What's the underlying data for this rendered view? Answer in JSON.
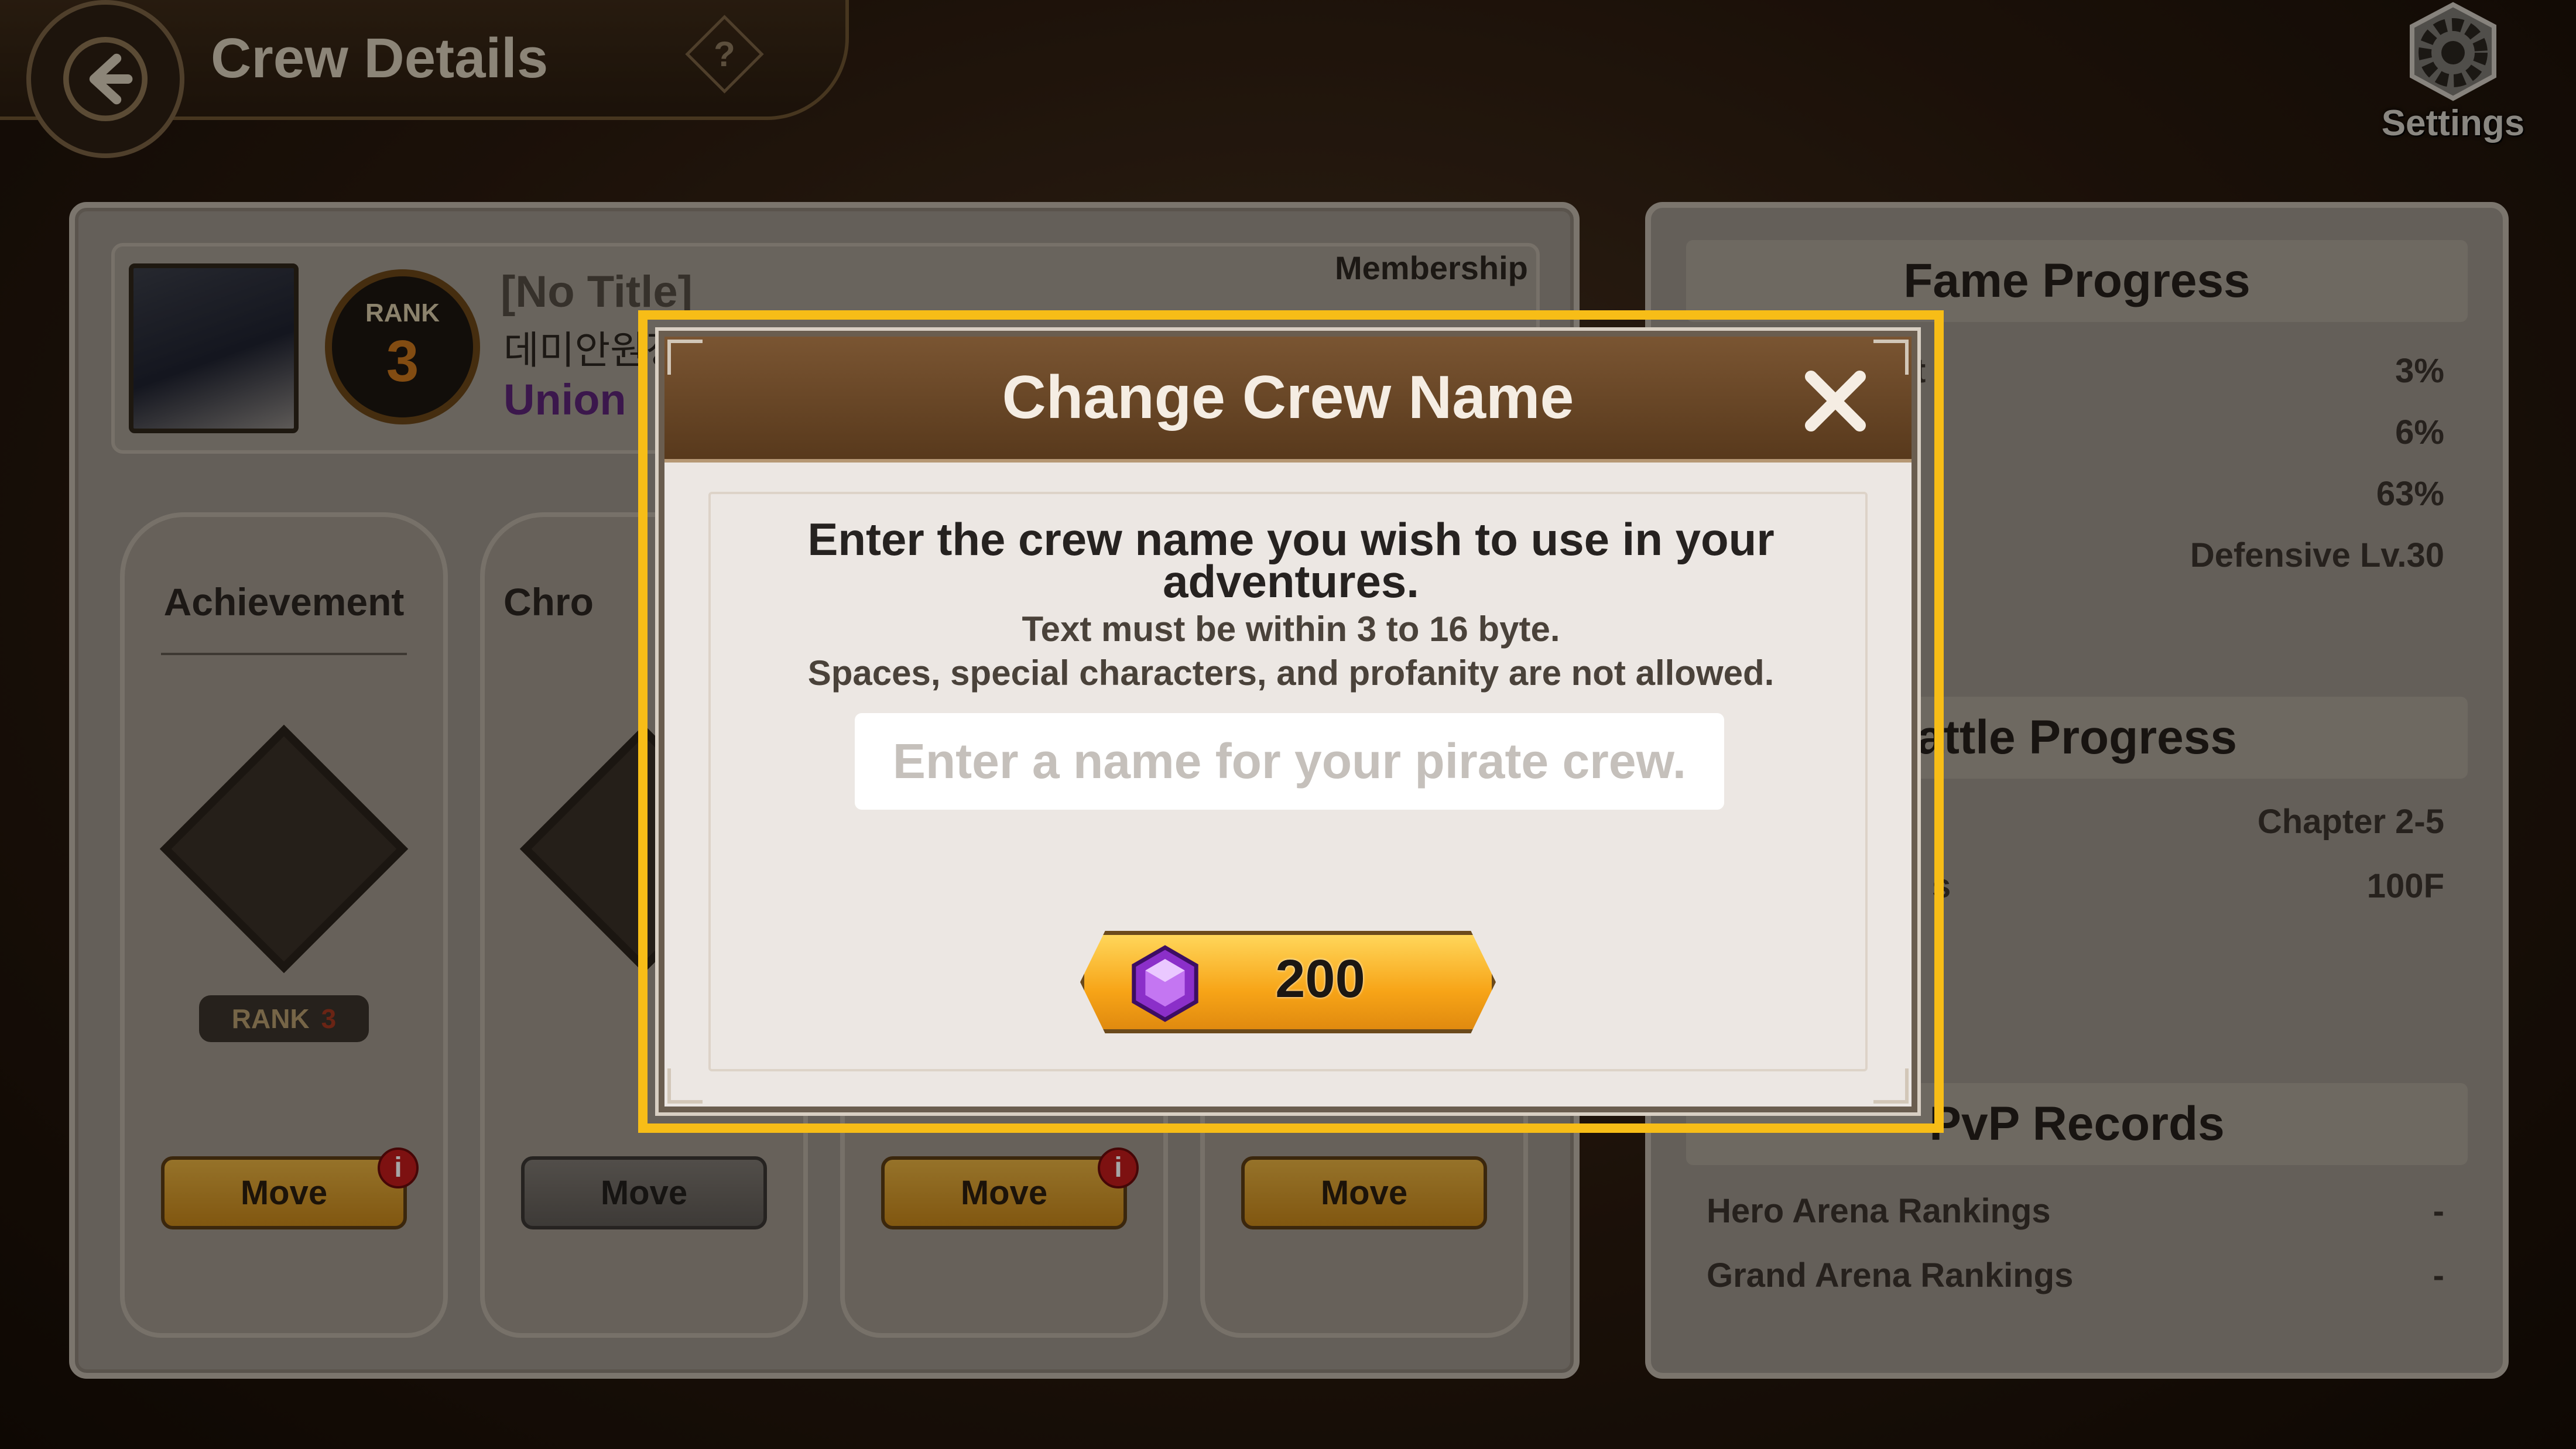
{
  "header": {
    "title": "Crew Details",
    "help_label": "?"
  },
  "settings": {
    "label": "Settings"
  },
  "profile": {
    "title": "[No Title]",
    "name": "데미안원정대",
    "union_label": "Union",
    "rank_label": "RANK",
    "rank_value": "3",
    "membership_label": "Membership"
  },
  "cards": [
    {
      "title": "Achievement",
      "rank_label": "RANK",
      "rank_value": "3",
      "button": "Move",
      "has_notification": true,
      "enabled": true
    },
    {
      "title": "Chro",
      "button": "Move",
      "has_notification": false,
      "enabled": false
    },
    {
      "title": "",
      "button": "Move",
      "has_notification": true,
      "enabled": true
    },
    {
      "title": "",
      "button": "Move",
      "has_notification": false,
      "enabled": true
    }
  ],
  "notification_glyph": "i",
  "right_panel": {
    "fame_progress": {
      "title": "Fame Progress",
      "values": [
        "3%",
        "6%",
        "63%",
        "Defensive Lv.30"
      ],
      "partial_label": "t"
    },
    "battle_progress": {
      "title": "attle Progress",
      "rows": [
        {
          "label": "",
          "value": "Chapter 2-5"
        },
        {
          "label": "s",
          "value": "100F"
        }
      ]
    },
    "pvp_records": {
      "title": "PvP Records",
      "rows": [
        {
          "label": "Hero Arena Rankings",
          "value": "-"
        },
        {
          "label": "Grand Arena Rankings",
          "value": "-"
        }
      ]
    }
  },
  "modal": {
    "title": "Change Crew Name",
    "close_icon": "close-icon",
    "prompt": "Enter the crew name you wish to use in your adventures.",
    "rule_length": "Text must be within 3 to 16 byte.",
    "rule_chars": "Spaces, special characters, and profanity are not allowed.",
    "input_value": "",
    "input_placeholder": "Enter a name for your pirate crew.",
    "cost": "200",
    "cost_icon": "gem-icon"
  },
  "colors": {
    "highlight": "#f7bd17",
    "modal_header": "#6a4626",
    "button_gold": "#f7a417",
    "union_purple": "#5b2476",
    "notification_red": "#c11b1b"
  }
}
